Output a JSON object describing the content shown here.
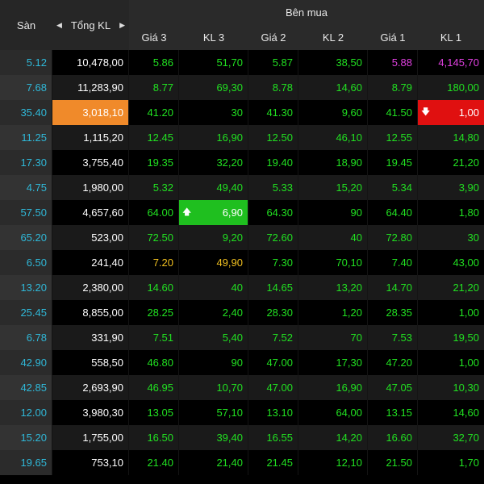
{
  "header": {
    "san": "Sàn",
    "tong_kl": "Tổng KL",
    "ben_mua": "Bên mua",
    "cols": [
      "Giá 3",
      "KL 3",
      "Giá 2",
      "KL 2",
      "Giá 1",
      "KL 1"
    ]
  },
  "icons": {
    "left_arrow": "◀",
    "right_arrow": "▶",
    "up": "🡅",
    "down": "🡇"
  },
  "colors": {
    "green": "#21e021",
    "yellow": "#f0c020",
    "magenta": "#e040e0",
    "cyan": "#2fb8d8",
    "orange": "#f08a2a",
    "red": "#e01010"
  },
  "rows": [
    {
      "san": "5.12",
      "tkl": "10,478,00",
      "g3": "5.86",
      "k3": "51,70",
      "g2": "5.87",
      "k2": "38,50",
      "g1": "5.88",
      "k1": "4,145,70",
      "g1c": "magenta",
      "k1c": "magenta"
    },
    {
      "san": "7.68",
      "tkl": "11,283,90",
      "g3": "8.77",
      "k3": "69,30",
      "g2": "8.78",
      "k2": "14,60",
      "g1": "8.79",
      "k1": "180,00"
    },
    {
      "san": "35.40",
      "tkl": "3,018,10",
      "g3": "41.20",
      "k3": "30",
      "g2": "41.30",
      "k2": "9,60",
      "g1": "41.50",
      "k1": "1,00",
      "tkl_hl": "orange",
      "k1_hl": "red"
    },
    {
      "san": "11.25",
      "tkl": "1,115,20",
      "g3": "12.45",
      "k3": "16,90",
      "g2": "12.50",
      "k2": "46,10",
      "g1": "12.55",
      "k1": "14,80"
    },
    {
      "san": "17.30",
      "tkl": "3,755,40",
      "g3": "19.35",
      "k3": "32,20",
      "g2": "19.40",
      "k2": "18,90",
      "g1": "19.45",
      "k1": "21,20"
    },
    {
      "san": "4.75",
      "tkl": "1,980,00",
      "g3": "5.32",
      "k3": "49,40",
      "g2": "5.33",
      "k2": "15,20",
      "g1": "5.34",
      "k1": "3,90"
    },
    {
      "san": "57.50",
      "tkl": "4,657,60",
      "g3": "64.00",
      "k3": "6,90",
      "g2": "64.30",
      "k2": "90",
      "g1": "64.40",
      "k1": "1,80",
      "k3_hl": "green"
    },
    {
      "san": "65.20",
      "tkl": "523,00",
      "g3": "72.50",
      "k3": "9,20",
      "g2": "72.60",
      "k2": "40",
      "g1": "72.80",
      "k1": "30"
    },
    {
      "san": "6.50",
      "tkl": "241,40",
      "g3": "7.20",
      "k3": "49,90",
      "g2": "7.30",
      "k2": "70,10",
      "g1": "7.40",
      "k1": "43,00",
      "g3c": "yellow",
      "k3c": "yellow"
    },
    {
      "san": "13.20",
      "tkl": "2,380,00",
      "g3": "14.60",
      "k3": "40",
      "g2": "14.65",
      "k2": "13,20",
      "g1": "14.70",
      "k1": "21,20"
    },
    {
      "san": "25.45",
      "tkl": "8,855,00",
      "g3": "28.25",
      "k3": "2,40",
      "g2": "28.30",
      "k2": "1,20",
      "g1": "28.35",
      "k1": "1,00"
    },
    {
      "san": "6.78",
      "tkl": "331,90",
      "g3": "7.51",
      "k3": "5,40",
      "g2": "7.52",
      "k2": "70",
      "g1": "7.53",
      "k1": "19,50"
    },
    {
      "san": "42.90",
      "tkl": "558,50",
      "g3": "46.80",
      "k3": "90",
      "g2": "47.00",
      "k2": "17,30",
      "g1": "47.20",
      "k1": "1,00"
    },
    {
      "san": "42.85",
      "tkl": "2,693,90",
      "g3": "46.95",
      "k3": "10,70",
      "g2": "47.00",
      "k2": "16,90",
      "g1": "47.05",
      "k1": "10,30"
    },
    {
      "san": "12.00",
      "tkl": "3,980,30",
      "g3": "13.05",
      "k3": "57,10",
      "g2": "13.10",
      "k2": "64,00",
      "g1": "13.15",
      "k1": "14,60"
    },
    {
      "san": "15.20",
      "tkl": "1,755,00",
      "g3": "16.50",
      "k3": "39,40",
      "g2": "16.55",
      "k2": "14,20",
      "g1": "16.60",
      "k1": "32,70"
    },
    {
      "san": "19.65",
      "tkl": "753,10",
      "g3": "21.40",
      "k3": "21,40",
      "g2": "21.45",
      "k2": "12,10",
      "g1": "21.50",
      "k1": "1,70"
    }
  ]
}
